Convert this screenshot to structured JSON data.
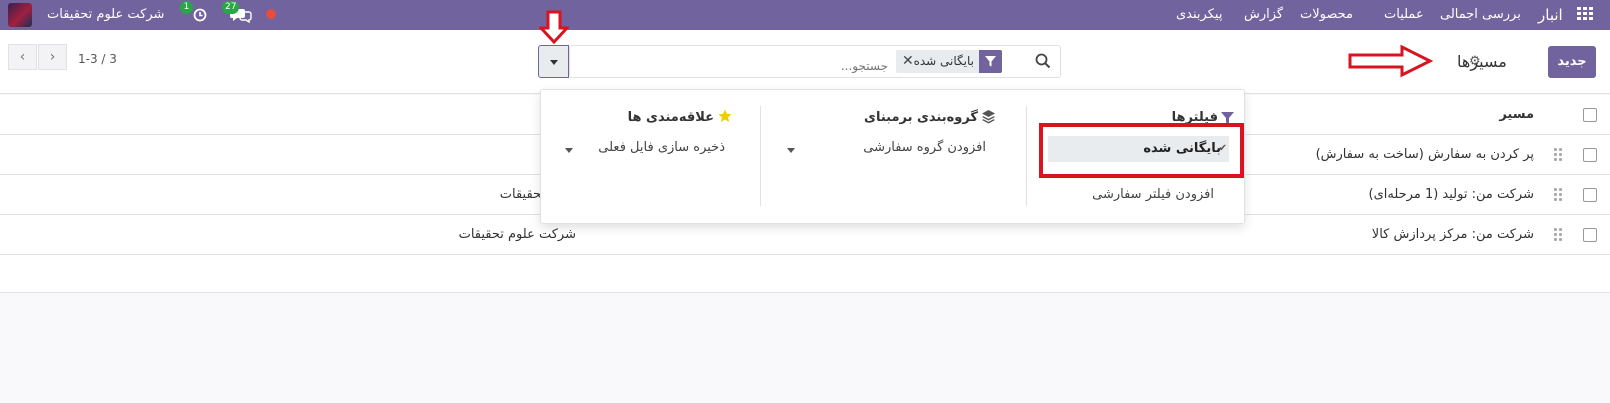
{
  "navbar": {
    "app_name": "انبار",
    "menu": [
      "بررسی اجمالی",
      "عملیات",
      "محصولات",
      "گزارش",
      "پیکربندی"
    ],
    "company": "شرکت علوم تحقیقات",
    "messages_count": "27",
    "activities_count": "1"
  },
  "control_panel": {
    "new_button": "جدید",
    "breadcrumb": "مسیرها",
    "search": {
      "facet_label": "بایگانی شده",
      "facet_remove": "✕",
      "placeholder": "جستجو..."
    },
    "pager": {
      "value": "1-3 / 3",
      "prev": "‹",
      "next": "›"
    }
  },
  "list": {
    "columns": [
      "مسیر"
    ],
    "rows": [
      {
        "name": "پر کردن به سفارش (ساخت به سفارش)",
        "company": ""
      },
      {
        "name": "شرکت من: تولید (1 مرحله‌ای)",
        "company": "علوم تحقیقات"
      },
      {
        "name": "شرکت من: مرکز پردازش کالا",
        "company": "شرکت علوم تحقیقات"
      }
    ]
  },
  "dropdown": {
    "filters_title": "فیلترها",
    "filter_selected": "بایگانی شده",
    "filter_custom": "افزودن فیلتر سفارشی",
    "groupby_title": "گروه‌بندی برمبنای",
    "groupby_custom": "افزودن گروه سفارشی",
    "favorites_title": "علاقه‌مندی ها",
    "favorites_save": "ذخیره سازی فایل فعلی"
  },
  "colors": {
    "brand": "#71639e",
    "annotation": "#d9131f",
    "badge": "#28a745",
    "favorite_star": "#f3cc00"
  }
}
